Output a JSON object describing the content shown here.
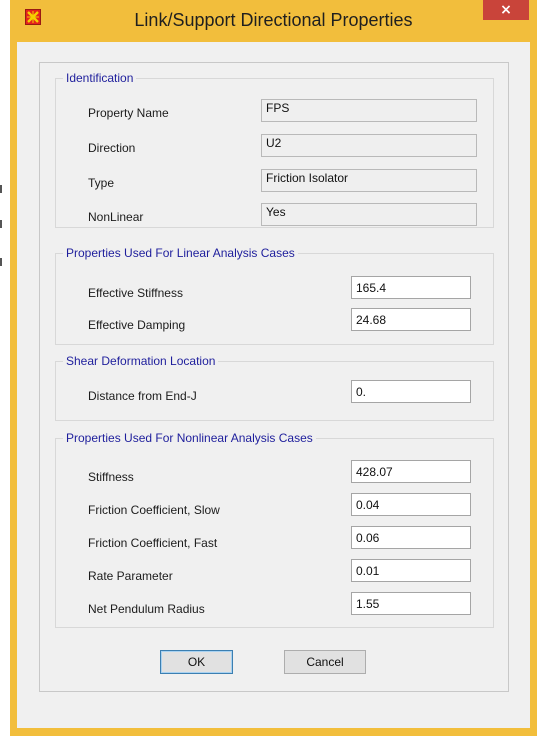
{
  "window": {
    "title": "Link/Support Directional Properties",
    "close_glyph": "×",
    "app_icon": "app-icon"
  },
  "identification": {
    "legend": "Identification",
    "property_name_label": "Property Name",
    "property_name_value": "FPS",
    "direction_label": "Direction",
    "direction_value": "U2",
    "type_label": "Type",
    "type_value": "Friction Isolator",
    "nonlinear_label": "NonLinear",
    "nonlinear_value": "Yes"
  },
  "linear": {
    "legend": "Properties Used For Linear Analysis Cases",
    "stiffness_label": "Effective Stiffness",
    "stiffness_value": "165.4",
    "damping_label": "Effective Damping",
    "damping_value": "24.68"
  },
  "shear": {
    "legend": "Shear Deformation Location",
    "distance_label": "Distance from End-J",
    "distance_value": "0."
  },
  "nonlinear": {
    "legend": "Properties Used For Nonlinear Analysis Cases",
    "stiffness_label": "Stiffness",
    "stiffness_value": "428.07",
    "friction_slow_label": "Friction Coefficient, Slow",
    "friction_slow_value": "0.04",
    "friction_fast_label": "Friction Coefficient, Fast",
    "friction_fast_value": "0.06",
    "rate_label": "Rate Parameter",
    "rate_value": "0.01",
    "radius_label": "Net Pendulum Radius",
    "radius_value": "1.55"
  },
  "buttons": {
    "ok": "OK",
    "cancel": "Cancel"
  },
  "colors": {
    "title_bar": "#f2be3c",
    "close_button": "#c9443a",
    "group_legend": "#1e1e9c",
    "dialog_background": "#f0f0f0"
  }
}
